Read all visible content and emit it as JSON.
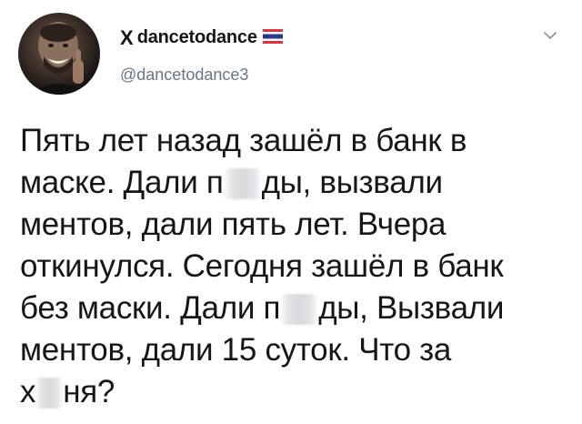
{
  "tweet": {
    "author": {
      "x_mark": "X",
      "display_name": "dancetodance",
      "flag_icon": "thailand-flag-icon",
      "handle": "@dancetodance3"
    },
    "menu_icon": "chevron-down-icon",
    "text_lines": [
      {
        "parts": [
          "Пять лет назад зашёл в банк в"
        ]
      },
      {
        "parts": [
          "маске. Дали п",
          "ды, вызвали"
        ]
      },
      {
        "parts": [
          "ментов, дали пять лет. Вчера"
        ]
      },
      {
        "parts": [
          "откинулся. Сегодня зашёл в банк"
        ]
      },
      {
        "parts": [
          "без маски. Дали п",
          "ды, Вызвали"
        ]
      },
      {
        "parts": [
          "ментов, дали 15 суток. Что за"
        ]
      },
      {
        "parts": [
          "х",
          "ня?"
        ]
      }
    ]
  },
  "colors": {
    "text": "#14171a",
    "secondary_text": "#657786",
    "flag_red": "#e0313f",
    "flag_blue": "#2b3a8f"
  }
}
